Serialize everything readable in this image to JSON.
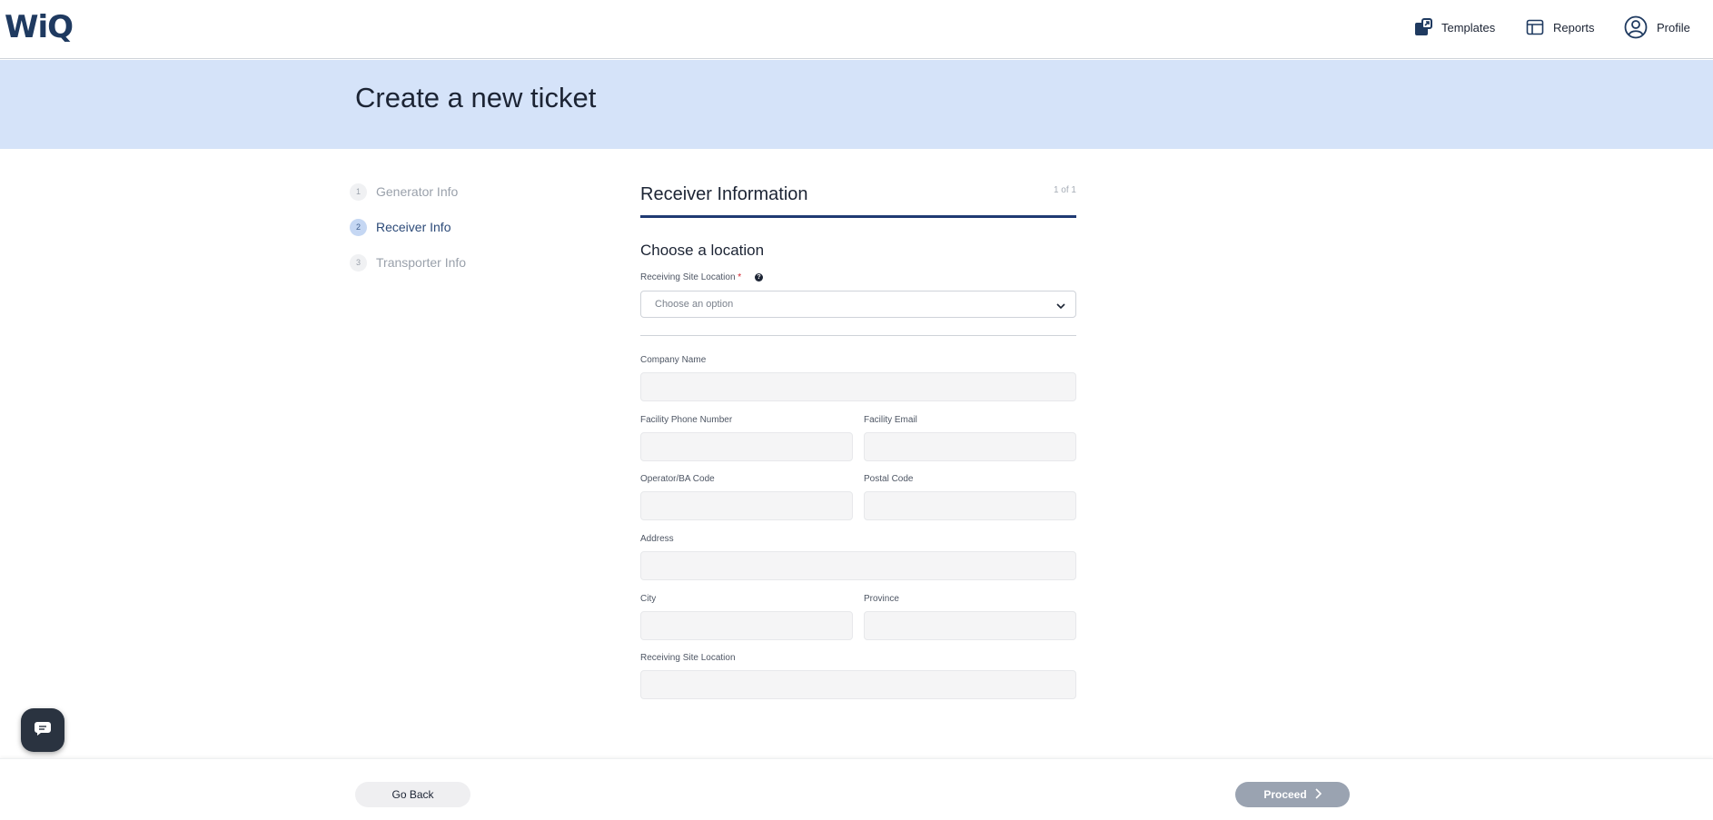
{
  "header": {
    "logo": "WiQ",
    "nav": [
      {
        "label": "Templates",
        "icon": "templates-icon"
      },
      {
        "label": "Reports",
        "icon": "reports-icon"
      },
      {
        "label": "Profile",
        "icon": "profile-icon"
      }
    ]
  },
  "banner": {
    "title": "Create a new ticket"
  },
  "stepper": {
    "steps": [
      {
        "num": "1",
        "label": "Generator Info",
        "state": "inactive"
      },
      {
        "num": "2",
        "label": "Receiver Info",
        "state": "active"
      },
      {
        "num": "3",
        "label": "Transporter Info",
        "state": "inactive"
      }
    ]
  },
  "form": {
    "section_title": "Receiver Information",
    "page_count": "1 of 1",
    "sub_title": "Choose a location",
    "location_field": {
      "label": "Receiving Site Location",
      "required_marker": "*",
      "help_icon": "question-circle-icon",
      "placeholder": "Choose an option"
    },
    "fields": {
      "company_name": {
        "label": "Company Name",
        "value": ""
      },
      "facility_phone": {
        "label": "Facility Phone Number",
        "value": ""
      },
      "facility_email": {
        "label": "Facility Email",
        "value": ""
      },
      "operator_code": {
        "label": "Operator/BA Code",
        "value": ""
      },
      "postal_code": {
        "label": "Postal Code",
        "value": ""
      },
      "address": {
        "label": "Address",
        "value": ""
      },
      "city": {
        "label": "City",
        "value": ""
      },
      "province": {
        "label": "Province",
        "value": ""
      },
      "receiving_site_location": {
        "label": "Receiving Site Location",
        "value": ""
      }
    }
  },
  "footer": {
    "back_label": "Go Back",
    "proceed_label": "Proceed"
  },
  "colors": {
    "banner_bg": "#d5e3f9",
    "accent": "#1f3a73",
    "proceed_disabled": "#9aa3b1"
  }
}
